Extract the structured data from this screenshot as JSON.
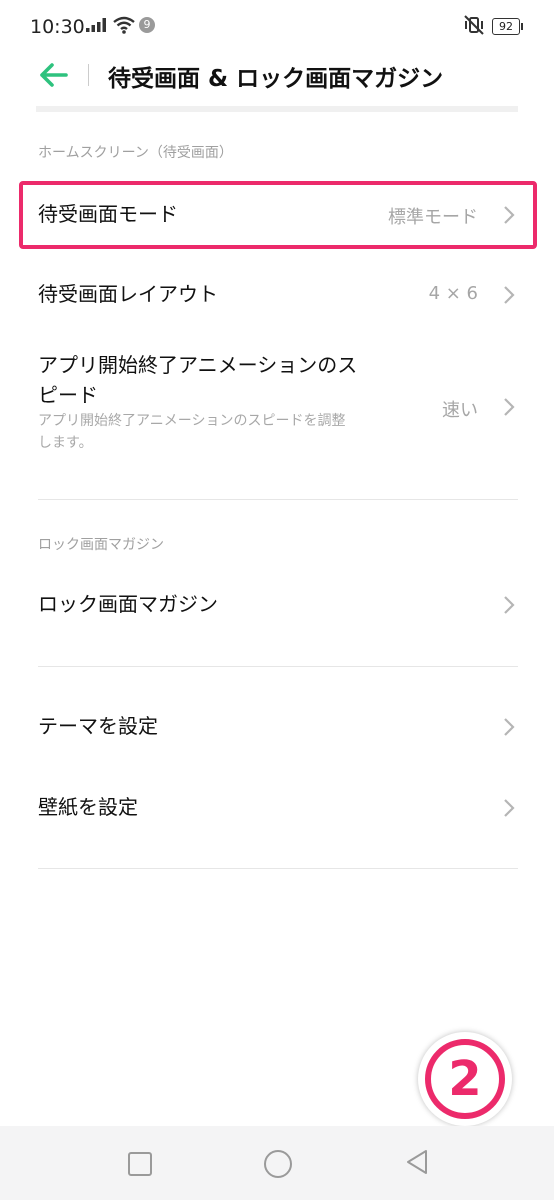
{
  "status_bar": {
    "time": "10:30",
    "notification_count": "9",
    "battery": "92"
  },
  "header": {
    "title": "待受画面 & ロック画面マガジン"
  },
  "sections": {
    "home": {
      "label": "ホームスクリーン（待受画面）"
    },
    "lock": {
      "label": "ロック画面マガジン"
    }
  },
  "rows": {
    "home_mode": {
      "title": "待受画面モード",
      "value": "標準モード"
    },
    "layout": {
      "title": "待受画面レイアウト",
      "value": "4 × 6"
    },
    "anim": {
      "title_line1": "アプリ開始終了アニメーションのス",
      "title_line2": "ピード",
      "sub_line1": "アプリ開始終了アニメーションのスピードを調整",
      "sub_line2": "します。",
      "value": "速い"
    },
    "lock_magazine": {
      "title": "ロック画面マガジン"
    },
    "theme": {
      "title": "テーマを設定"
    },
    "wallpaper": {
      "title": "壁紙を設定"
    }
  },
  "annotation": {
    "step": "2"
  },
  "colors": {
    "accent_green": "#2ec27e",
    "highlight_pink": "#ec2a6b"
  },
  "icons": [
    "back-arrow-icon",
    "chevron-right-icon",
    "signal-icon",
    "wifi-icon",
    "vibrate-off-icon",
    "battery-icon",
    "nav-recent-icon",
    "nav-home-icon",
    "nav-back-icon"
  ]
}
